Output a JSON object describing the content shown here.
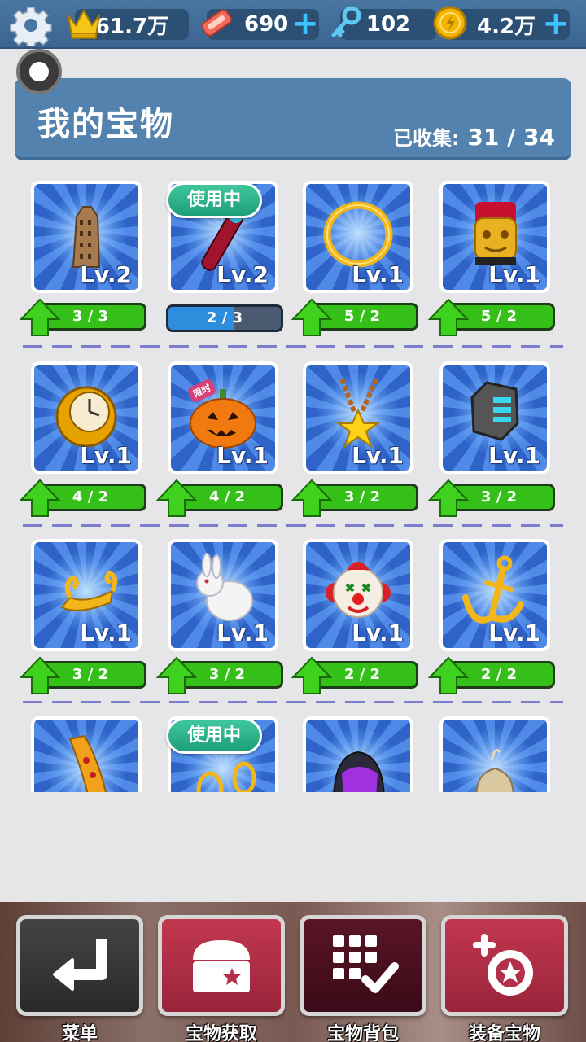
{
  "topbar": {
    "crown": "61.7万",
    "tickets": "690",
    "keys": "102",
    "coins": "4.2万",
    "plus": "+"
  },
  "header": {
    "title": "我的宝物",
    "collected_label": "已收集:",
    "collected_value": "31 / 34"
  },
  "badges": {
    "in_use": "使用中",
    "limited": "限时"
  },
  "items": [
    {
      "name": "tower",
      "level": "Lv.2",
      "progress": "3 / 3",
      "upgradable": true
    },
    {
      "name": "hoverboard",
      "level": "Lv.2",
      "progress": "2 / 3",
      "upgradable": false,
      "in_use": true,
      "fill": 0.58
    },
    {
      "name": "ring",
      "level": "Lv.1",
      "progress": "5 / 2",
      "upgradable": true
    },
    {
      "name": "tiki-mask",
      "level": "Lv.1",
      "progress": "5 / 2",
      "upgradable": true
    },
    {
      "name": "pocket-watch",
      "level": "Lv.1",
      "progress": "4 / 2",
      "upgradable": true
    },
    {
      "name": "pumpkin",
      "level": "Lv.1",
      "progress": "4 / 2",
      "upgradable": true,
      "limited": true
    },
    {
      "name": "star-necklace",
      "level": "Lv.1",
      "progress": "3 / 2",
      "upgradable": true
    },
    {
      "name": "battery-gadget",
      "level": "Lv.1",
      "progress": "3 / 2",
      "upgradable": true
    },
    {
      "name": "golden-scroll",
      "level": "Lv.1",
      "progress": "3 / 2",
      "upgradable": true
    },
    {
      "name": "white-rabbit",
      "level": "Lv.1",
      "progress": "3 / 2",
      "upgradable": true
    },
    {
      "name": "clown-mask",
      "level": "Lv.1",
      "progress": "2 / 2",
      "upgradable": true
    },
    {
      "name": "anchor",
      "level": "Lv.1",
      "progress": "2 / 2",
      "upgradable": true
    },
    {
      "name": "golden-horn",
      "level": "",
      "progress": "",
      "upgradable": false
    },
    {
      "name": "golden-rings",
      "level": "",
      "progress": "",
      "upgradable": false,
      "in_use": true
    },
    {
      "name": "helmet",
      "level": "",
      "progress": "",
      "upgradable": false
    },
    {
      "name": "sack",
      "level": "",
      "progress": "",
      "upgradable": false
    }
  ],
  "nav": {
    "menu": "菜单",
    "obtain": "宝物获取",
    "backpack": "宝物背包",
    "equip": "装备宝物"
  },
  "colors": {
    "topbar": "#3b6590",
    "header": "#5482af",
    "progress_green": "#34c018",
    "in_use_badge": "#1d9e78",
    "nav_dark": "#333333",
    "nav_red": "#b3304a",
    "nav_maroon": "#4a0f1f"
  }
}
